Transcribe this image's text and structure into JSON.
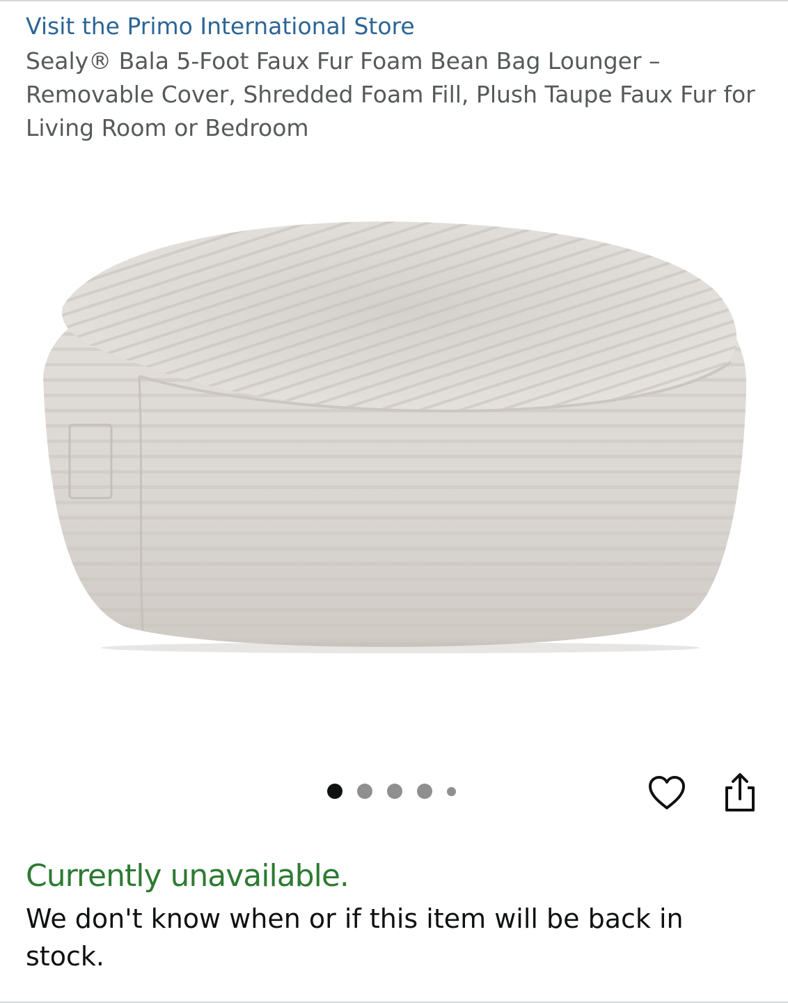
{
  "store": {
    "link_text": "Visit the Primo International Store"
  },
  "product": {
    "title": "Sealy® Bala 5-Foot Faux Fur Foam Bean Bag Lounger – Removable Cover, Shredded Foam Fill, Plush Taupe Faux Fur for Living Room or Bedroom"
  },
  "gallery": {
    "image_count": 5,
    "active_index": 0
  },
  "actions": {
    "wishlist_icon": "heart-icon",
    "share_icon": "share-icon"
  },
  "availability": {
    "status": "Currently unavailable.",
    "note": "We don't know when or if this item will be back in stock."
  },
  "colors": {
    "link": "#2c6596",
    "title": "#565959",
    "status": "#2d7a32",
    "text": "#0f1111"
  }
}
